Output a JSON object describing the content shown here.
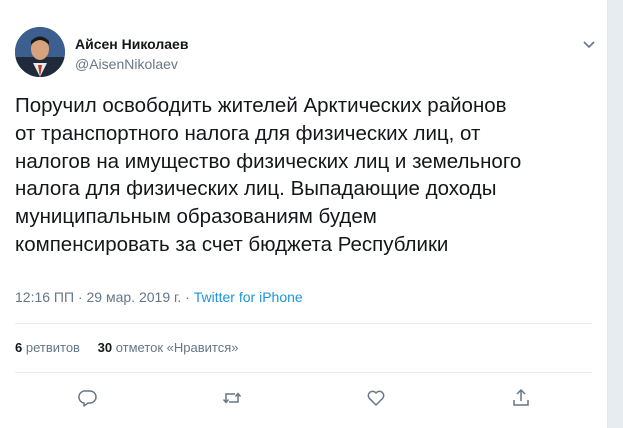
{
  "author": {
    "name": "Айсен Николаев",
    "handle": "@AisenNikolaev"
  },
  "tweet": {
    "text": "Поручил освободить жителей Арктических районов\nот транспортного налога для физических лиц, от\nналогов на имущество физических лиц и земельного\nналога для физических лиц. Выпадающие доходы\nмуниципальным образованиям будем\nкомпенсировать за счет бюджета Республики",
    "time": "12:16 ПП",
    "separator": " · ",
    "date": "29 мар. 2019 г.",
    "source": "Twitter for iPhone"
  },
  "stats": {
    "retweets_count": "6",
    "retweets_label": "ретвитов",
    "likes_count": "30",
    "likes_label": "отметок «Нравится»"
  },
  "icons": {
    "menu": "chevron-down-icon",
    "reply": "reply-icon",
    "retweet": "retweet-icon",
    "like": "heart-icon",
    "share": "share-icon"
  },
  "colors": {
    "text": "#14171a",
    "secondary": "#657786",
    "link": "#1b95e0",
    "divider": "#e6ecf0"
  }
}
